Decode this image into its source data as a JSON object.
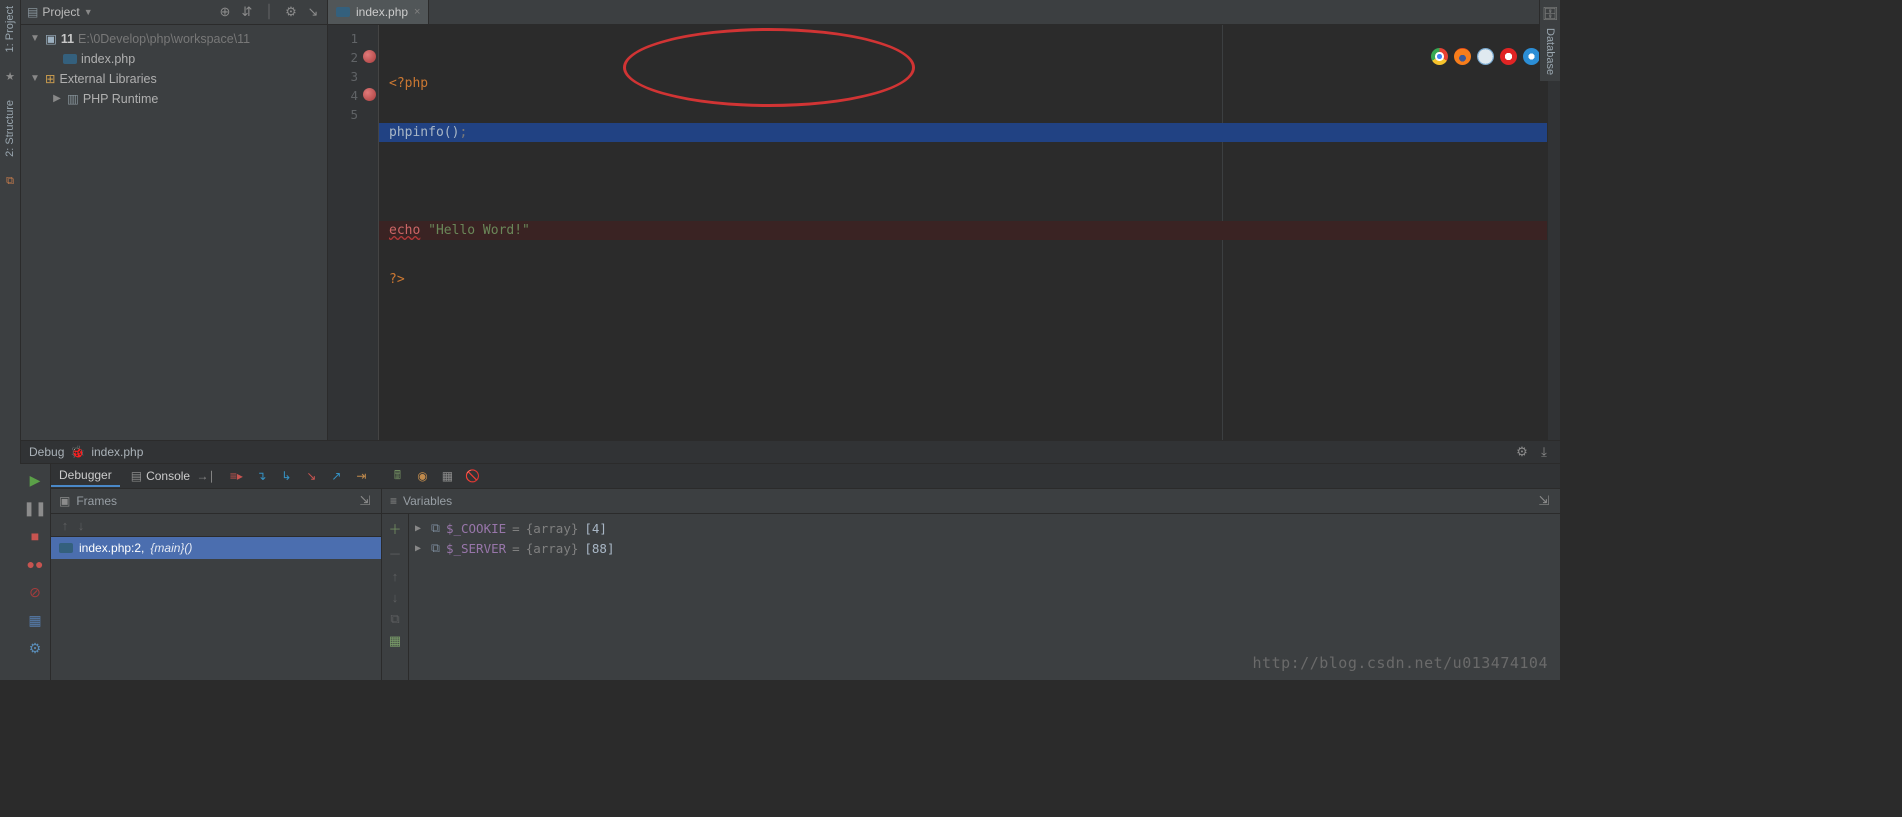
{
  "leftStrip": {
    "projectLabel": "1: Project",
    "structureLabel": "2: Structure"
  },
  "rightStrip": {
    "databaseLabel": "Database"
  },
  "projectPanel": {
    "selectorLabel": "Project",
    "toolbarIcons": [
      "⊕",
      "⇵",
      "⎮",
      "⚙",
      "↘"
    ],
    "tree": {
      "rootName": "11",
      "rootPath": "E:\\0Develop\\php\\workspace\\11",
      "file": "index.php",
      "extLibLabel": "External Libraries",
      "runtimeLabel": "PHP Runtime"
    }
  },
  "editor": {
    "tabName": "index.php",
    "lines": [
      "<?php",
      "phpinfo();",
      "",
      "echo \"Hello Word!\"",
      "?>"
    ],
    "lineNumbers": [
      "1",
      "2",
      "3",
      "4",
      "5"
    ]
  },
  "debugHeader": {
    "label": "Debug",
    "file": "index.php"
  },
  "debugTabs": {
    "debugger": "Debugger",
    "console": "Console"
  },
  "frames": {
    "header": "Frames",
    "stack": {
      "file": "index.php:2,",
      "func": "{main}()"
    }
  },
  "variables": {
    "header": "Variables",
    "rows": [
      {
        "name": "$_COOKIE",
        "type": "{array}",
        "size": "[4]"
      },
      {
        "name": "$_SERVER",
        "type": "{array}",
        "size": "[88]"
      }
    ]
  },
  "watermark": "http://blog.csdn.net/u013474104"
}
